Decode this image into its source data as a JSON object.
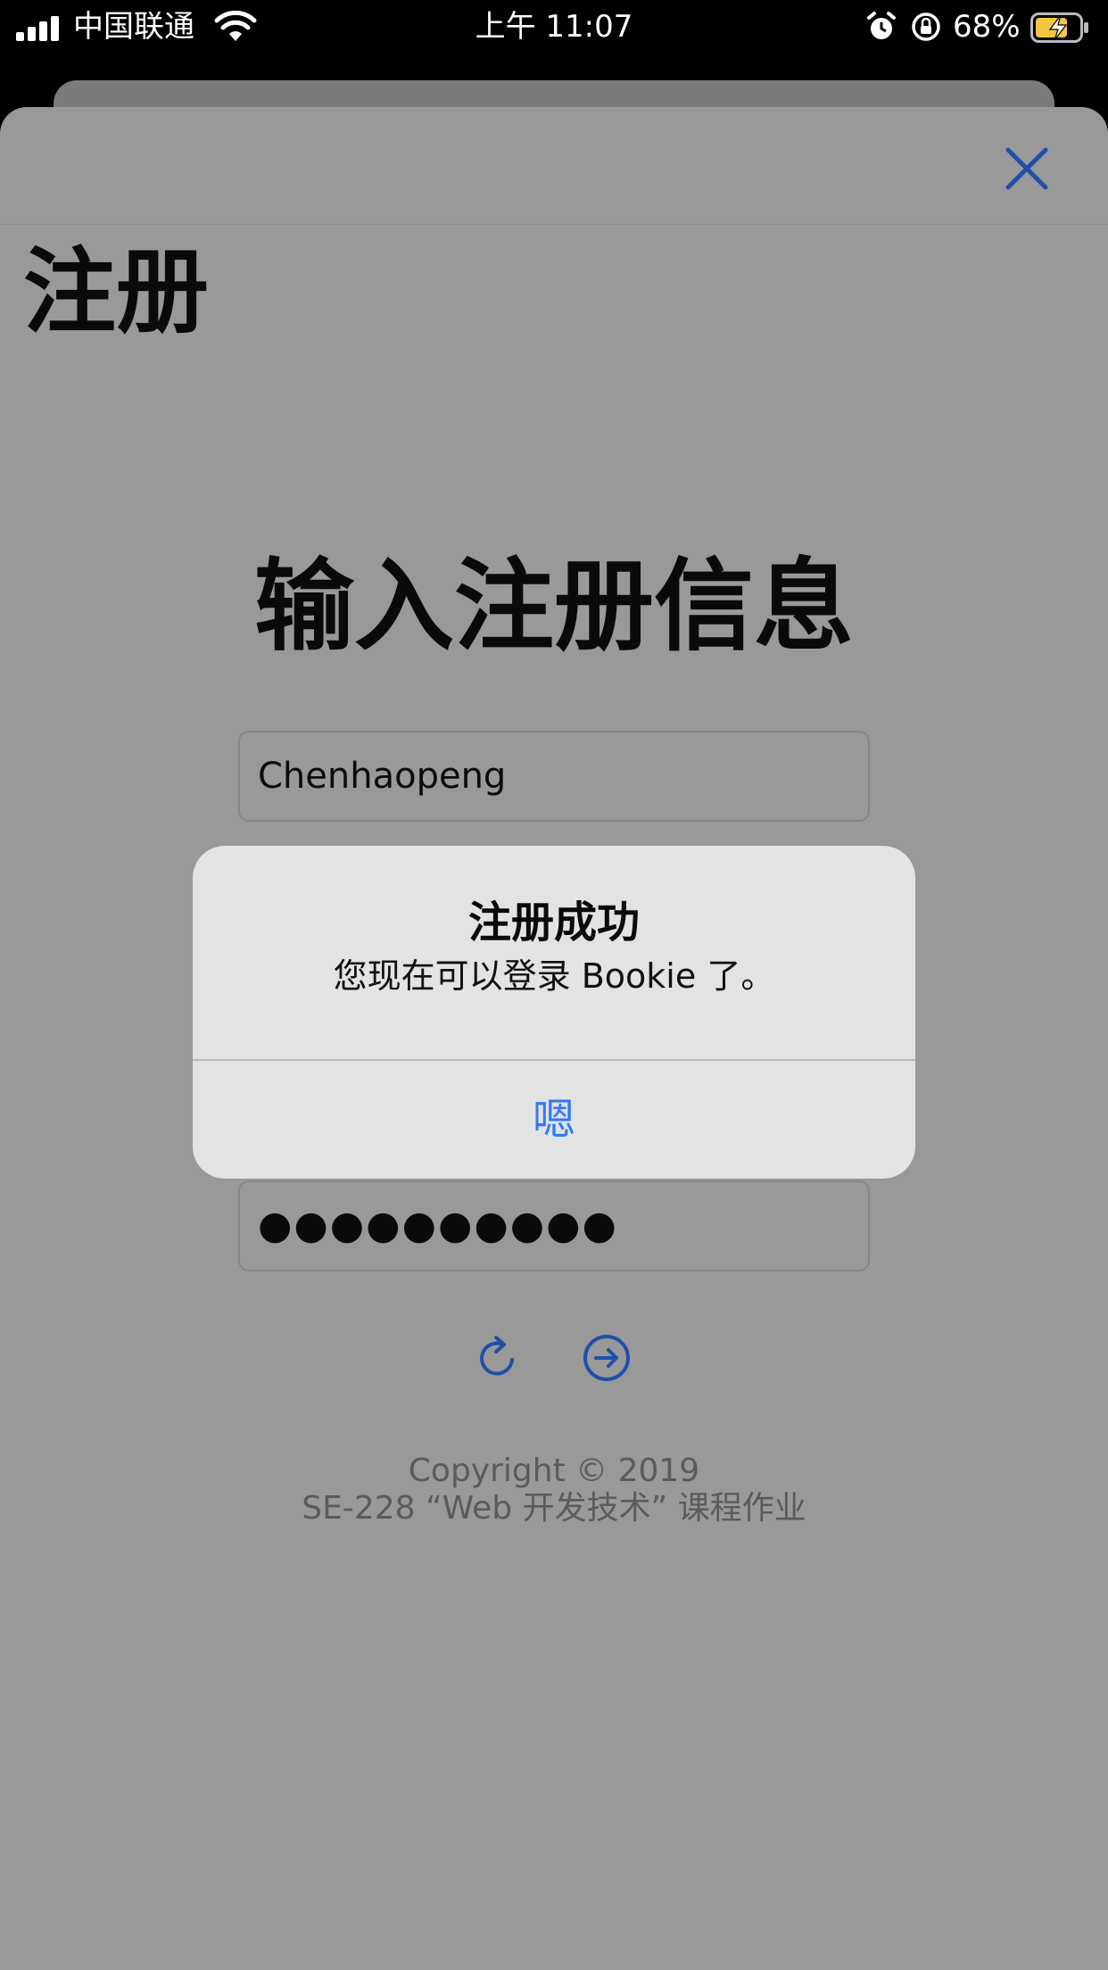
{
  "status_bar": {
    "carrier": "中国联通",
    "time": "上午 11:07",
    "battery_percent": "68%"
  },
  "nav": {
    "large_title": "注册",
    "close_icon": "close-icon"
  },
  "form": {
    "title": "输入注册信息",
    "username_value": "Chenhaopeng",
    "password_value": "●●●●●●●●●●",
    "reset_icon": "refresh-icon",
    "submit_icon": "arrow-right-circle-icon"
  },
  "footer": {
    "copyright": "Copyright © 2019",
    "course": "SE-228 “Web 开发技术” 课程作业"
  },
  "alert": {
    "title": "注册成功",
    "message": "您现在可以登录 Bookie 了。",
    "ok_label": "嗯"
  },
  "colors": {
    "accent": "#3478f6",
    "icon_blue": "#1f4fa8",
    "overlay_gray": "#999999"
  }
}
